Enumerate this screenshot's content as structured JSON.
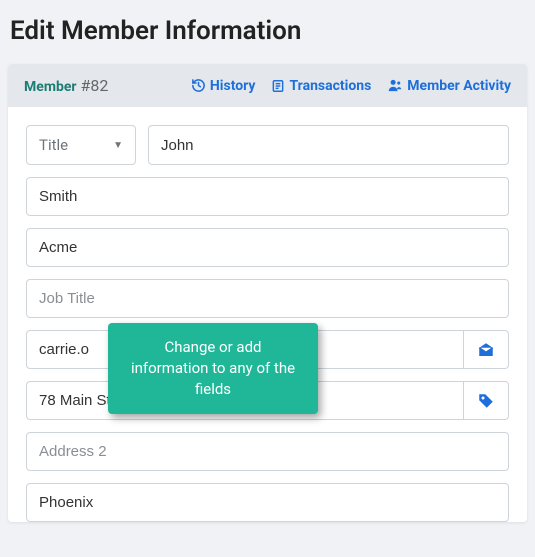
{
  "page_title": "Edit Member Information",
  "header": {
    "member_label": "Member",
    "member_id": "#82",
    "links": {
      "history": "History",
      "transactions": "Transactions",
      "activity": "Member Activity"
    }
  },
  "form": {
    "title_placeholder": "Title",
    "first_name": "John",
    "last_name": "Smith",
    "company": "Acme",
    "job_title_placeholder": "Job Title",
    "job_title": "",
    "email": "carrie.o",
    "address1": "78 Main Street",
    "address2_placeholder": "Address 2",
    "address2": "",
    "city": "Phoenix"
  },
  "tooltip": {
    "text": "Change or add information to any of the fields"
  }
}
